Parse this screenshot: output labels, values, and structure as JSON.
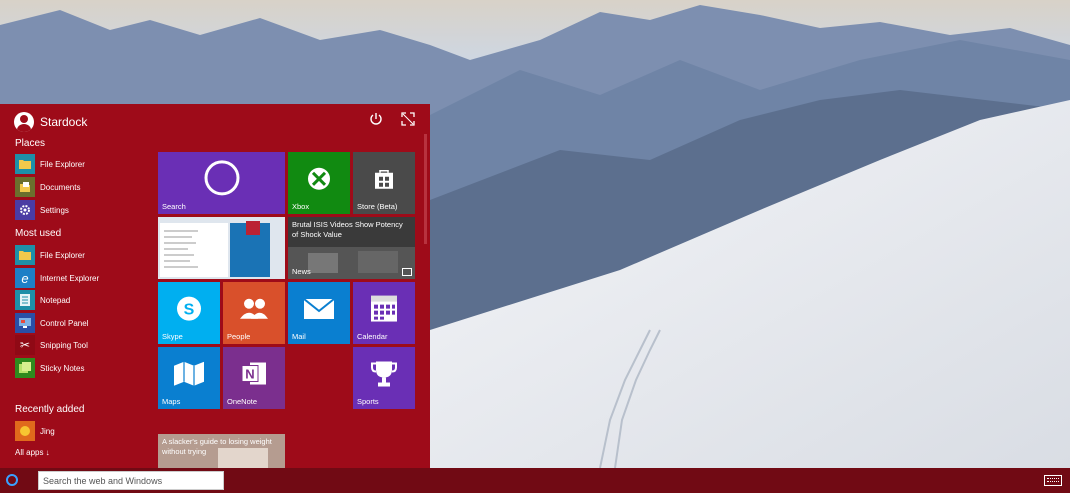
{
  "user": {
    "name": "Stardock"
  },
  "header": {
    "power_icon": "power-icon",
    "expand_icon": "expand-icon"
  },
  "places": {
    "title": "Places",
    "items": [
      {
        "label": "File Explorer",
        "icon": "folder-icon",
        "color": "#1e8fa8"
      },
      {
        "label": "Documents",
        "icon": "documents-icon",
        "color": "#6b6f2d"
      },
      {
        "label": "Settings",
        "icon": "gear-icon",
        "color": "#4b3ca3"
      }
    ]
  },
  "most_used": {
    "title": "Most used",
    "items": [
      {
        "label": "File Explorer",
        "icon": "folder-icon",
        "color": "#1e8fa8"
      },
      {
        "label": "Internet Explorer",
        "icon": "internet-explorer-icon",
        "color": "#1d7fc6"
      },
      {
        "label": "Notepad",
        "icon": "notepad-icon",
        "color": "#1e8fa8"
      },
      {
        "label": "Control Panel",
        "icon": "control-panel-icon",
        "color": "#2a4fa6"
      },
      {
        "label": "Snipping Tool",
        "icon": "scissors-icon",
        "color": "#8f0915"
      },
      {
        "label": "Sticky Notes",
        "icon": "sticky-notes-icon",
        "color": "#2f8a1e"
      }
    ]
  },
  "recently_added": {
    "title": "Recently added",
    "items": [
      {
        "label": "Jing",
        "icon": "jing-icon",
        "color": "#e06a1c"
      }
    ]
  },
  "all_apps": "All apps ↓",
  "tiles": {
    "search": "Search",
    "xbox": "Xbox",
    "store": "Store (Beta)",
    "news": "News",
    "news_headline": "Brutal ISIS Videos Show Potency of Shock Value",
    "skype": "Skype",
    "people": "People",
    "mail": "Mail",
    "calendar": "Calendar",
    "maps": "Maps",
    "onenote": "OneNote",
    "sports": "Sports",
    "article_headline": "A slacker's guide to losing weight without trying"
  },
  "colors": {
    "start_bg": "#9e0b19",
    "taskbar_bg": "#710a14",
    "purple": "#6a2fb5",
    "green": "#118a11",
    "blue": "#0a7fd0",
    "skype": "#00aff0",
    "people": "#d9502b"
  },
  "taskbar": {
    "search_placeholder": "Search the web and Windows",
    "cortana_icon": "cortana-icon",
    "keyboard_icon": "keyboard-icon"
  }
}
